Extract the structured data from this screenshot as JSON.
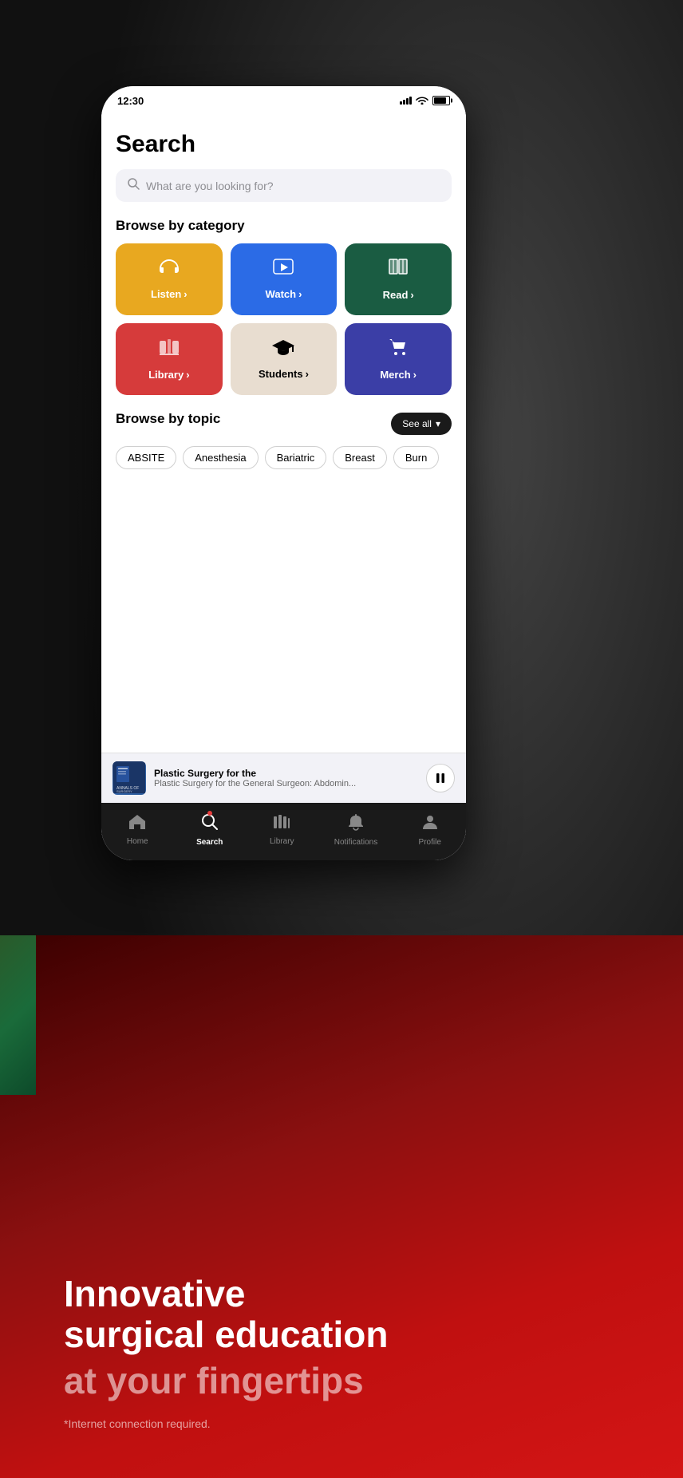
{
  "status_bar": {
    "time": "12:30"
  },
  "page": {
    "title": "Search",
    "search_placeholder": "What are you looking for?"
  },
  "browse_category": {
    "section_title": "Browse by category",
    "categories": [
      {
        "id": "listen",
        "label": "Listen",
        "icon": "headphones",
        "color": "listen"
      },
      {
        "id": "watch",
        "label": "Watch",
        "icon": "play",
        "color": "watch"
      },
      {
        "id": "read",
        "label": "Read",
        "icon": "book",
        "color": "read"
      },
      {
        "id": "library",
        "label": "Library",
        "icon": "library",
        "color": "library"
      },
      {
        "id": "students",
        "label": "Students",
        "icon": "graduation",
        "color": "students"
      },
      {
        "id": "merch",
        "label": "Merch",
        "icon": "cart",
        "color": "merch"
      }
    ]
  },
  "browse_topic": {
    "section_title": "Browse by topic",
    "see_all_label": "See all",
    "topics": [
      {
        "id": "absite",
        "label": "ABSITE"
      },
      {
        "id": "anesthesia",
        "label": "Anesthesia"
      },
      {
        "id": "bariatric",
        "label": "Bariatric"
      },
      {
        "id": "breast",
        "label": "Breast"
      },
      {
        "id": "burn",
        "label": "Burn"
      }
    ]
  },
  "now_playing": {
    "title": "Plastic Surgery for the General Surgeon: Abdomin...",
    "subtitle": "Plastic Surgery for the General Surgeon: Abdomin..."
  },
  "bottom_nav": {
    "items": [
      {
        "id": "home",
        "label": "Home",
        "icon": "home",
        "active": false
      },
      {
        "id": "search",
        "label": "Search",
        "icon": "search",
        "active": true,
        "has_dot": true
      },
      {
        "id": "library",
        "label": "Library",
        "icon": "library-nav",
        "active": false
      },
      {
        "id": "notifications",
        "label": "Notifications",
        "icon": "bell",
        "active": false
      },
      {
        "id": "profile",
        "label": "Profile",
        "icon": "person",
        "active": false
      }
    ]
  },
  "promo": {
    "line1": "Innovative",
    "line2": "surgical education",
    "line3": "at your fingertips",
    "note": "*Internet connection required."
  }
}
